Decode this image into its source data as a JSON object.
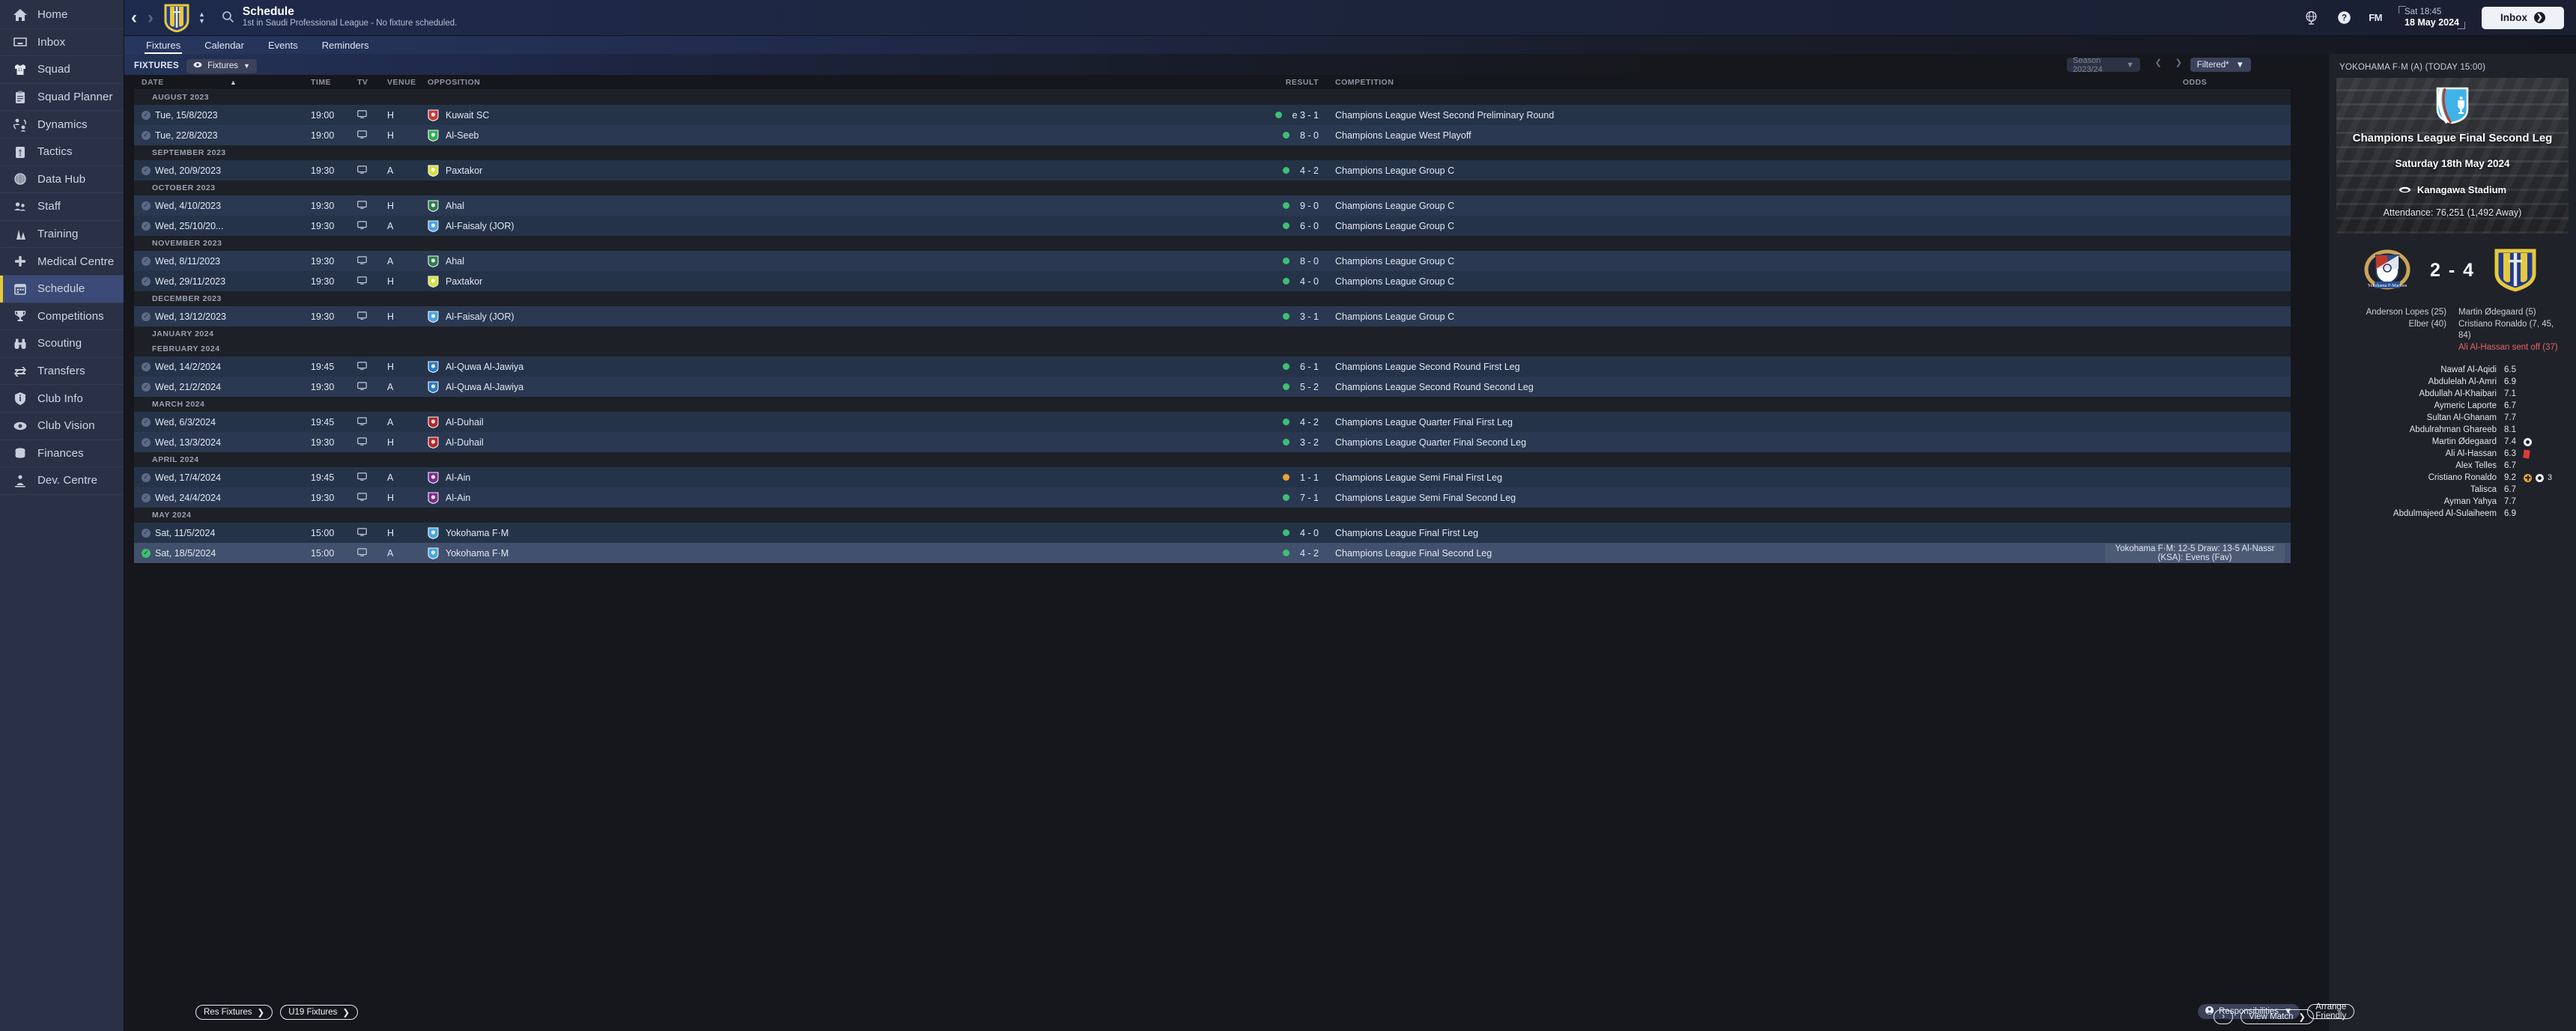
{
  "sidebar": {
    "items": [
      {
        "label": "Home",
        "icon": "home-icon"
      },
      {
        "label": "Inbox",
        "icon": "inbox-icon"
      },
      {
        "label": "Squad",
        "icon": "shirt-icon"
      },
      {
        "label": "Squad Planner",
        "icon": "clipboard-icon"
      },
      {
        "label": "Dynamics",
        "icon": "people-swap-icon"
      },
      {
        "label": "Tactics",
        "icon": "tactics-board-icon"
      },
      {
        "label": "Data Hub",
        "icon": "sphere-icon"
      },
      {
        "label": "Staff",
        "icon": "staff-people-icon"
      },
      {
        "label": "Training",
        "icon": "training-icon"
      },
      {
        "label": "Medical Centre",
        "icon": "medical-cross-icon"
      },
      {
        "label": "Schedule",
        "icon": "calendar-icon"
      },
      {
        "label": "Competitions",
        "icon": "trophy-icon"
      },
      {
        "label": "Scouting",
        "icon": "binoculars-icon"
      },
      {
        "label": "Transfers",
        "icon": "transfer-arrows-icon"
      },
      {
        "label": "Club Info",
        "icon": "info-shield-icon"
      },
      {
        "label": "Club Vision",
        "icon": "eye-icon"
      },
      {
        "label": "Finances",
        "icon": "coins-icon"
      },
      {
        "label": "Dev. Centre",
        "icon": "development-icon"
      }
    ],
    "active": "Schedule"
  },
  "header": {
    "back_arrow": "‹",
    "forward_arrow": "›",
    "title": "Schedule",
    "subtitle": "1st in Saudi Professional League - No fixture scheduled.",
    "search_placeholder": "",
    "clock_time": "Sat 18:45",
    "clock_date": "18 May 2024",
    "fm_logo": "FM",
    "inbox_label": "Inbox",
    "icons": [
      "globe-icon",
      "help-icon"
    ]
  },
  "tabs": [
    {
      "label": "Fixtures",
      "active": true
    },
    {
      "label": "Calendar",
      "active": false
    },
    {
      "label": "Events",
      "active": false
    },
    {
      "label": "Reminders",
      "active": false
    }
  ],
  "toolbar": {
    "section_label": "FIXTURES",
    "view_pill": "Fixtures",
    "season": "Season 2023/24",
    "filter_label": "Filtered*"
  },
  "table": {
    "columns": [
      "DATE",
      "TIME",
      "TV",
      "VENUE",
      "OPPOSITION",
      "RESULT",
      "COMPETITION",
      "ODDS"
    ],
    "sort_column": "DATE",
    "sort_dir": "asc",
    "groups": [
      {
        "month": "AUGUST 2023",
        "rows": [
          {
            "date": "Tue, 15/8/2023",
            "time": "19:00",
            "tv": true,
            "venue": "H",
            "opposition": "Kuwait SC",
            "badge": "#c73b3b",
            "result_dot": "green",
            "result": "e 3 - 1",
            "competition": "Champions League West Second Preliminary Round",
            "odds": "",
            "selected": false,
            "played": true
          },
          {
            "date": "Tue, 22/8/2023",
            "time": "19:00",
            "tv": true,
            "venue": "H",
            "opposition": "Al-Seeb",
            "badge": "#2fae52",
            "result_dot": "green",
            "result": "8 - 0",
            "competition": "Champions League West Playoff",
            "odds": "",
            "selected": false,
            "played": true
          }
        ]
      },
      {
        "month": "SEPTEMBER 2023",
        "rows": [
          {
            "date": "Wed, 20/9/2023",
            "time": "19:30",
            "tv": true,
            "venue": "A",
            "opposition": "Paxtakor",
            "badge": "#d6e03c",
            "result_dot": "green",
            "result": "4 - 2",
            "competition": "Champions League Group C",
            "odds": "",
            "selected": false,
            "played": true
          }
        ]
      },
      {
        "month": "OCTOBER 2023",
        "rows": [
          {
            "date": "Wed, 4/10/2023",
            "time": "19:30",
            "tv": true,
            "venue": "H",
            "opposition": "Ahal",
            "badge": "#2e7d4f",
            "result_dot": "green",
            "result": "9 - 0",
            "competition": "Champions League Group C",
            "odds": "",
            "selected": false,
            "played": true
          },
          {
            "date": "Wed, 25/10/20...",
            "time": "19:30",
            "tv": true,
            "venue": "A",
            "opposition": "Al-Faisaly (JOR)",
            "badge": "#4ba3e3",
            "result_dot": "green",
            "result": "6 - 0",
            "competition": "Champions League Group C",
            "odds": "",
            "selected": false,
            "played": true
          }
        ]
      },
      {
        "month": "NOVEMBER 2023",
        "rows": [
          {
            "date": "Wed, 8/11/2023",
            "time": "19:30",
            "tv": true,
            "venue": "A",
            "opposition": "Ahal",
            "badge": "#2e7d4f",
            "result_dot": "green",
            "result": "8 - 0",
            "competition": "Champions League Group C",
            "odds": "",
            "selected": false,
            "played": true
          },
          {
            "date": "Wed, 29/11/2023",
            "time": "19:30",
            "tv": true,
            "venue": "H",
            "opposition": "Paxtakor",
            "badge": "#d6e03c",
            "result_dot": "green",
            "result": "4 - 0",
            "competition": "Champions League Group C",
            "odds": "",
            "selected": false,
            "played": true
          }
        ]
      },
      {
        "month": "DECEMBER 2023",
        "rows": [
          {
            "date": "Wed, 13/12/2023",
            "time": "19:30",
            "tv": true,
            "venue": "H",
            "opposition": "Al-Faisaly (JOR)",
            "badge": "#4ba3e3",
            "result_dot": "green",
            "result": "3 - 1",
            "competition": "Champions League Group C",
            "odds": "",
            "selected": false,
            "played": true
          }
        ]
      },
      {
        "month": "JANUARY 2024",
        "rows": []
      },
      {
        "month": "FEBRUARY 2024",
        "rows": [
          {
            "date": "Wed, 14/2/2024",
            "time": "19:45",
            "tv": true,
            "venue": "H",
            "opposition": "Al-Quwa Al-Jawiya",
            "badge": "#2b7cc4",
            "result_dot": "green",
            "result": "6 - 1",
            "competition": "Champions League Second Round First Leg",
            "odds": "",
            "selected": false,
            "played": true
          },
          {
            "date": "Wed, 21/2/2024",
            "time": "19:30",
            "tv": true,
            "venue": "A",
            "opposition": "Al-Quwa Al-Jawiya",
            "badge": "#2b7cc4",
            "result_dot": "green",
            "result": "5 - 2",
            "competition": "Champions League Second Round Second Leg",
            "odds": "",
            "selected": false,
            "played": true
          }
        ]
      },
      {
        "month": "MARCH 2024",
        "rows": [
          {
            "date": "Wed, 6/3/2024",
            "time": "19:45",
            "tv": true,
            "venue": "A",
            "opposition": "Al-Duhail",
            "badge": "#b22a2a",
            "result_dot": "green",
            "result": "4 - 2",
            "competition": "Champions League Quarter Final First Leg",
            "odds": "",
            "selected": false,
            "played": true
          },
          {
            "date": "Wed, 13/3/2024",
            "time": "19:30",
            "tv": true,
            "venue": "H",
            "opposition": "Al-Duhail",
            "badge": "#b22a2a",
            "result_dot": "green",
            "result": "3 - 2",
            "competition": "Champions League Quarter Final Second Leg",
            "odds": "",
            "selected": false,
            "played": true
          }
        ]
      },
      {
        "month": "APRIL 2024",
        "rows": [
          {
            "date": "Wed, 17/4/2024",
            "time": "19:45",
            "tv": true,
            "venue": "A",
            "opposition": "Al-Ain",
            "badge": "#7b2d8e",
            "result_dot": "amber",
            "result": "1 - 1",
            "competition": "Champions League Semi Final First Leg",
            "odds": "",
            "selected": false,
            "played": true
          },
          {
            "date": "Wed, 24/4/2024",
            "time": "19:30",
            "tv": true,
            "venue": "H",
            "opposition": "Al-Ain",
            "badge": "#7b2d8e",
            "result_dot": "green",
            "result": "7 - 1",
            "competition": "Champions League Semi Final Second Leg",
            "odds": "",
            "selected": false,
            "played": true
          }
        ]
      },
      {
        "month": "MAY 2024",
        "rows": [
          {
            "date": "Sat, 11/5/2024",
            "time": "15:00",
            "tv": true,
            "venue": "H",
            "opposition": "Yokohama F·M",
            "badge": "#4aa8dd",
            "result_dot": "green",
            "result": "4 - 0",
            "competition": "Champions League Final First Leg",
            "odds": "",
            "selected": false,
            "played": true
          },
          {
            "date": "Sat, 18/5/2024",
            "time": "15:00",
            "tv": true,
            "venue": "A",
            "opposition": "Yokohama F·M",
            "badge": "#4aa8dd",
            "result_dot": "green",
            "result": "4 - 2",
            "competition": "Champions League Final Second Leg",
            "odds": "Yokohama F·M: 12-5 Draw: 13-5 Al-Nassr (KSA): Evens (Fav)",
            "selected": true,
            "played": true
          }
        ]
      }
    ]
  },
  "footer": {
    "res_fixtures": "Res Fixtures",
    "u19_fixtures": "U19 Fixtures",
    "responsibilities": "Responsibilities",
    "arrange_friendly": "Arrange Friendly",
    "next_arrow": "›",
    "view_match": "View Match"
  },
  "right_panel": {
    "header": "YOKOHAMA F·M (A) (TODAY 15:00)",
    "competition": "Champions League Final Second Leg",
    "date": "Saturday 18th May 2024",
    "stadium": "Kanagawa Stadium",
    "attendance": "Attendance: 76,251 (1,492 Away)",
    "home_score": "2",
    "away_score": "4",
    "score_separator": "-",
    "home_scorers": [
      "Anderson Lopes (25)",
      "Elber (40)"
    ],
    "away_scorers": [
      "Martin Ødegaard (5)",
      "Cristiano Ronaldo (7, 45, 84)"
    ],
    "away_sent_off": "Ali Al-Hassan sent off (37)",
    "ratings": [
      {
        "name": "Nawaf Al-Aqidi",
        "rating": "6.5",
        "icons": []
      },
      {
        "name": "Abdulelah Al-Amri",
        "rating": "6.9",
        "icons": []
      },
      {
        "name": "Abdullah Al-Khaibari",
        "rating": "7.1",
        "icons": []
      },
      {
        "name": "Aymeric Laporte",
        "rating": "6.7",
        "icons": []
      },
      {
        "name": "Sultan Al-Ghanam",
        "rating": "7.7",
        "icons": []
      },
      {
        "name": "Abdulrahman Ghareeb",
        "rating": "8.1",
        "icons": []
      },
      {
        "name": "Martin Ødegaard",
        "rating": "7.4",
        "icons": [
          "goal"
        ]
      },
      {
        "name": "Ali Al-Hassan",
        "rating": "6.3",
        "icons": [
          "red-card"
        ]
      },
      {
        "name": "Alex Telles",
        "rating": "6.7",
        "icons": []
      },
      {
        "name": "Cristiano Ronaldo",
        "rating": "9.2",
        "icons": [
          "assist",
          "goal"
        ],
        "goal_count": "3"
      },
      {
        "name": "Talisca",
        "rating": "6.7",
        "icons": []
      },
      {
        "name": "Ayman Yahya",
        "rating": "7.7",
        "icons": []
      },
      {
        "name": "Abdulmajeed Al-Sulaiheem",
        "rating": "6.9",
        "icons": []
      }
    ]
  },
  "colors": {
    "brand_yellow": "#e8c83c",
    "brand_blue": "#1f3b8c",
    "win_green": "#3fbf74",
    "draw_amber": "#e8a33d",
    "red_card": "#e03b3b",
    "selected_row": "#41506c"
  }
}
